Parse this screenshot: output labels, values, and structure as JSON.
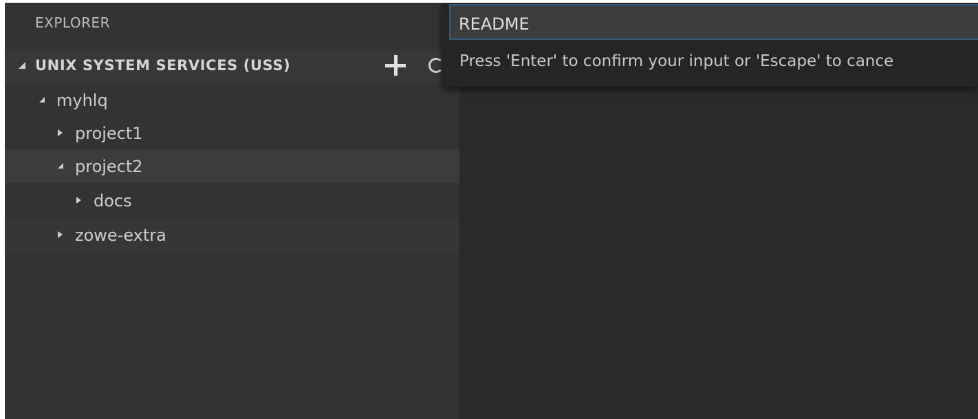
{
  "sidebar": {
    "title": "EXPLORER",
    "section": {
      "title": "UNIX SYSTEM SERVICES (USS)",
      "add_icon": "plus-icon",
      "refresh_icon": "refresh-icon"
    },
    "tree": [
      {
        "label": "myhlq",
        "level": 0,
        "expanded": true
      },
      {
        "label": "project1",
        "level": 1,
        "expanded": false
      },
      {
        "label": "project2",
        "level": 1,
        "expanded": true
      },
      {
        "label": "docs",
        "level": 2,
        "expanded": false
      },
      {
        "label": "zowe-extra",
        "level": 1,
        "expanded": false
      }
    ]
  },
  "quick_input": {
    "value": "README",
    "message": "Press 'Enter' to confirm your input or 'Escape' to cance"
  }
}
